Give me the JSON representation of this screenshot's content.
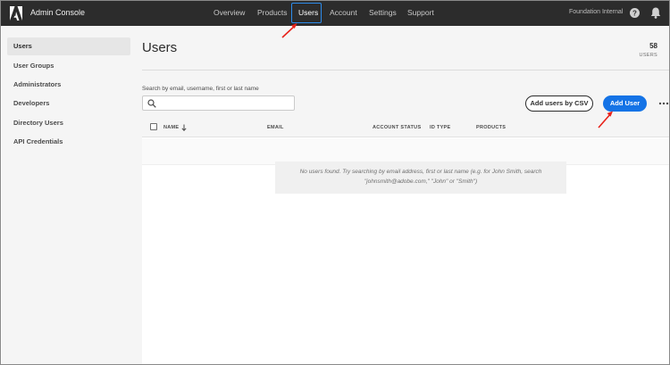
{
  "app": {
    "title": "Admin Console",
    "org_name": "Foundation Internal"
  },
  "nav": {
    "items": [
      {
        "label": "Overview"
      },
      {
        "label": "Products"
      },
      {
        "label": "Users",
        "active": true
      },
      {
        "label": "Account"
      },
      {
        "label": "Settings"
      },
      {
        "label": "Support"
      }
    ]
  },
  "icons": {
    "logo": "adobe-logo-icon",
    "help": "help-icon",
    "notifications": "bell-icon",
    "search": "search-icon",
    "more": "more-icon",
    "sort": "arrow-down-icon"
  },
  "sidebar": {
    "items": [
      {
        "label": "Users",
        "active": true
      },
      {
        "label": "User Groups"
      },
      {
        "label": "Administrators"
      },
      {
        "label": "Developers"
      },
      {
        "label": "Directory Users"
      },
      {
        "label": "API Credentials"
      }
    ]
  },
  "main": {
    "title": "Users",
    "user_count": "58",
    "user_count_label": "USERS",
    "search": {
      "label": "Search by email, username, first or last name",
      "value": "",
      "placeholder": ""
    },
    "buttons": {
      "csv": "Add users by CSV",
      "add_user": "Add User"
    },
    "table": {
      "columns": [
        "NAME",
        "EMAIL",
        "ACCOUNT STATUS",
        "ID TYPE",
        "PRODUCTS"
      ]
    },
    "empty_message_line1": "No users found. Try searching by email address, first or last name (e.g. for John Smith, search",
    "empty_message_line2": "\"johnsmith@adobe.com,\" \"John\" or \"Smith\")"
  },
  "colors": {
    "topbar": "#2c2c2c",
    "accent": "#1473e6",
    "highlight": "#2d8ceb",
    "annotation": "#e8231b"
  }
}
